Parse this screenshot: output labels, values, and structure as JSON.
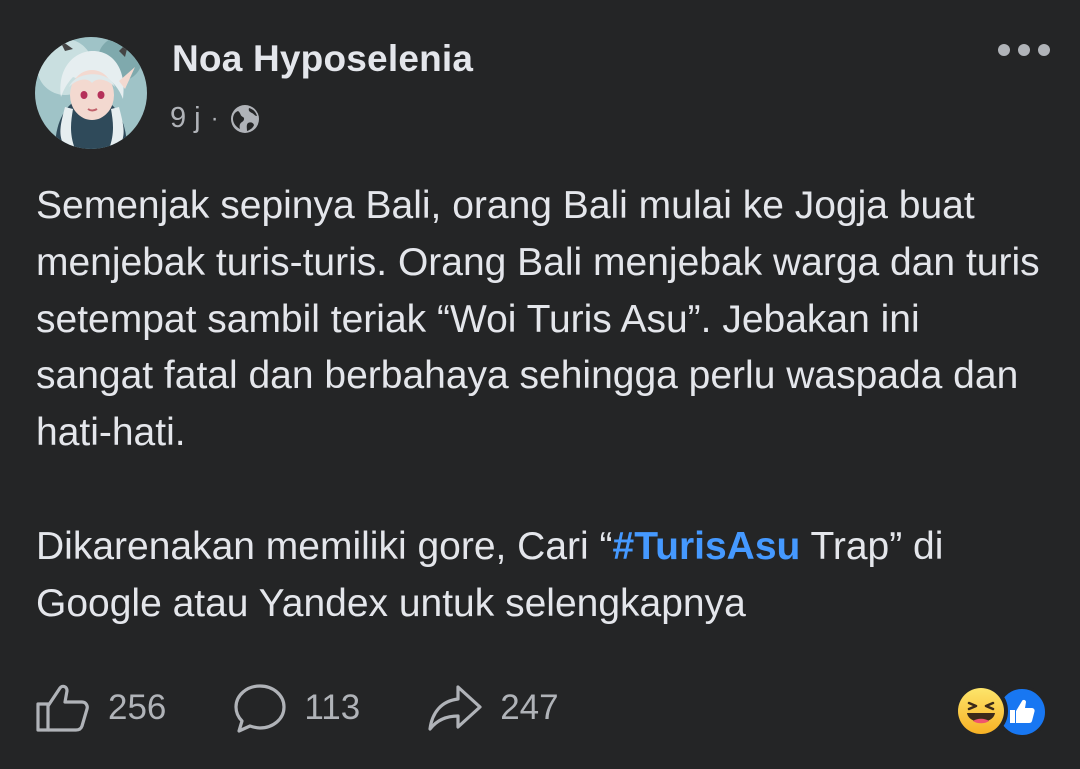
{
  "post": {
    "author": "Noa Hyposelenia",
    "time": "9 j",
    "separator": "·",
    "privacy_icon": "globe-icon",
    "more_icon": "more-dots-icon",
    "paragraph1": "Semenjak sepinya Bali, orang Bali mulai ke Jogja buat menjebak turis-turis. Orang Bali menjebak warga dan turis setempat sambil teriak “Woi Turis Asu”. Jebakan ini sangat fatal dan berbahaya sehingga perlu waspada dan hati-hati.",
    "paragraph2_before": "Dikarenakan memiliki gore, Cari “",
    "hashtag": "#TurisAsu",
    "paragraph2_after": " Trap” di Google atau Yandex untuk selengkapnya"
  },
  "actions": {
    "like_count": "256",
    "comment_count": "113",
    "share_count": "247"
  },
  "reactions": [
    "haha-icon",
    "like-icon"
  ],
  "colors": {
    "background": "#242526",
    "text": "#e4e6eb",
    "secondary": "#b0b3b8",
    "hashtag": "#4599ff",
    "like_blue": "#1877f2"
  }
}
